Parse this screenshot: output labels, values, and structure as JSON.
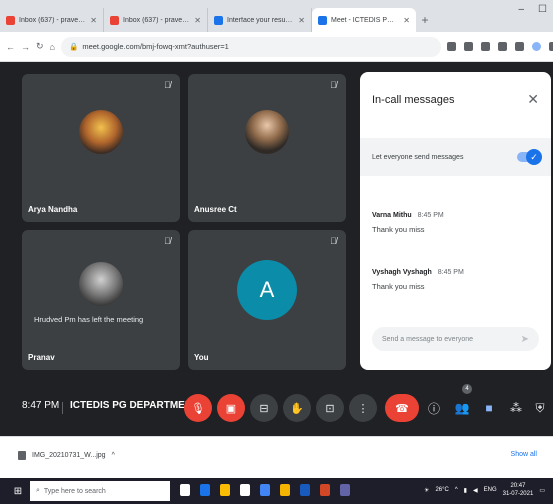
{
  "browser": {
    "tabs": [
      {
        "label": "Inbox (637) - praveenvs0@...",
        "favicon_color": "#ea4335",
        "active": false
      },
      {
        "label": "Inbox (637) - praveenvs@g...",
        "favicon_color": "#ea4335",
        "active": false
      },
      {
        "label": "Interface your resume (1) - E...",
        "favicon_color": "#1a73e8",
        "active": false
      },
      {
        "label": "Meet - ICTEDIS PG DEPARTM...",
        "favicon_color": "#1a73e8",
        "active": true
      }
    ],
    "url": "meet.google.com/bmj-fowq-xmt?authuser=1"
  },
  "meet": {
    "participants": [
      {
        "name": "Arya Nandha",
        "muted": true
      },
      {
        "name": "Anusree Ct",
        "muted": true
      },
      {
        "name": "Pranav",
        "muted": true
      },
      {
        "name": "You",
        "initial": "A",
        "avatar_color": "#0b8ca8",
        "muted": true
      }
    ],
    "toast": "Hrudved Pm has left the meeting",
    "panel": {
      "title": "In-call messages",
      "toggle_label": "Let everyone send messages",
      "toggle_on": true,
      "messages": [
        {
          "sender": "Varna Mithu",
          "time": "8:45 PM",
          "text": "Thank you miss"
        },
        {
          "sender": "Vyshagh Vyshagh",
          "time": "8:45 PM",
          "text": "Thank you miss"
        }
      ],
      "compose_placeholder": "Send a message to everyone"
    },
    "controls": {
      "time": "8:47 PM",
      "meeting_title": "ICTEDIS PG DEPARTMEN...",
      "participant_count": "4"
    }
  },
  "downloads": {
    "item": "IMG_20210731_W...jpg",
    "show_all": "Show all"
  },
  "taskbar": {
    "search_placeholder": "Type here to search",
    "temperature": "26°C",
    "language": "ENG",
    "time": "20:47",
    "date": "31-07-2021"
  },
  "colors": {
    "meet_bg": "#202124",
    "tile_bg": "#3c4043",
    "accent_blue": "#1a73e8",
    "end_call_red": "#ea4335"
  }
}
